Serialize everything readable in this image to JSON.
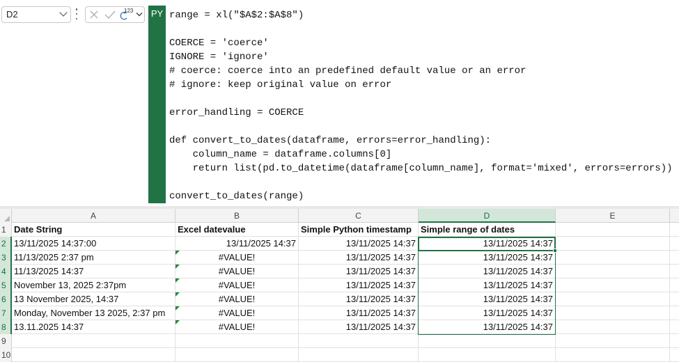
{
  "name_box": {
    "value": "D2"
  },
  "formula_bar": {
    "mode_label": "PY",
    "superscript": "123",
    "code_lines": [
      "range = xl(\"$A$2:$A$8\")",
      "",
      "COERCE = 'coerce'",
      "IGNORE = 'ignore'",
      "# coerce: coerce into an predefined default value or an error",
      "# ignore: keep original value on error",
      "",
      "error_handling = COERCE",
      "",
      "def convert_to_dates(dataframe, errors=error_handling):",
      "    column_name = dataframe.columns[0]",
      "    return list(pd.to_datetime(dataframe[column_name], format='mixed', errors=errors))",
      "",
      "convert_to_dates(range)"
    ]
  },
  "columns": [
    "A",
    "B",
    "C",
    "D",
    "E"
  ],
  "row_numbers": [
    "1",
    "2",
    "3",
    "4",
    "5",
    "6",
    "7",
    "8",
    "9",
    "10"
  ],
  "header_row": {
    "a": "Date String",
    "b": "Excel datevalue",
    "c": "Simple Python timestamp",
    "d": "Simple range of dates"
  },
  "data_rows": [
    {
      "a": "13/11/2025  14:37:00",
      "b": "13/11/2025 14:37",
      "c": "13/11/2025 14:37",
      "d": "13/11/2025 14:37"
    },
    {
      "a": "11/13/2025 2:37 pm",
      "b": "#VALUE!",
      "c": "13/11/2025 14:37",
      "d": "13/11/2025 14:37"
    },
    {
      "a": "11/13/2025  14:37",
      "b": "#VALUE!",
      "c": "13/11/2025 14:37",
      "d": "13/11/2025 14:37"
    },
    {
      "a": "November 13, 2025 2:37pm",
      "b": "#VALUE!",
      "c": "13/11/2025 14:37",
      "d": "13/11/2025 14:37"
    },
    {
      "a": "13 November 2025, 14:37",
      "b": "#VALUE!",
      "c": "13/11/2025 14:37",
      "d": "13/11/2025 14:37"
    },
    {
      "a": "Monday, November 13 2025, 2:37 pm",
      "b": "#VALUE!",
      "c": "13/11/2025 14:37",
      "d": "13/11/2025 14:37"
    },
    {
      "a": "13.11.2025 14:37",
      "b": "#VALUE!",
      "c": "13/11/2025 14:37",
      "d": "13/11/2025 14:37"
    }
  ],
  "colors": {
    "accent": "#217346",
    "selected_header": "#d2e7da",
    "warning_triangle": "#1e8a3c"
  }
}
